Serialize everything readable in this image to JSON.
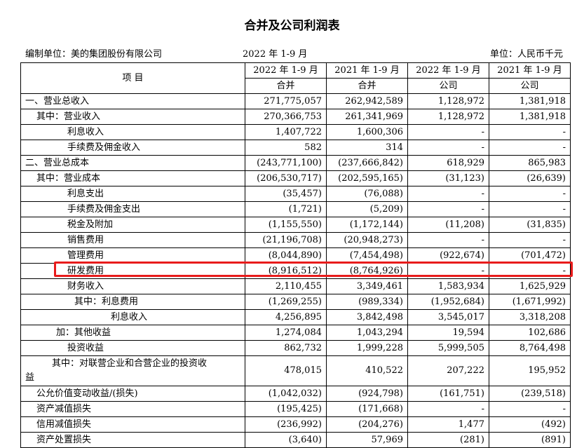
{
  "title": "合并及公司利润表",
  "meta": {
    "company": "编制单位：美的集团股份有限公司",
    "period": "2022 年 1-9 月",
    "unit": "单位：人民币千元"
  },
  "header": {
    "item": "项  目",
    "periods": [
      "2022 年 1-9 月",
      "2021 年 1-9 月",
      "2022 年 1-9 月",
      "2021 年 1-9 月"
    ],
    "scopes": [
      "合并",
      "合并",
      "公司",
      "公司"
    ]
  },
  "rows": [
    {
      "label": "一、营业总收入",
      "values": [
        "271,775,057",
        "262,942,589",
        "1,128,972",
        "1,381,918"
      ]
    },
    {
      "label": "其中：营业收入",
      "values": [
        "270,366,753",
        "261,341,969",
        "1,128,972",
        "1,381,918"
      ]
    },
    {
      "label": "利息收入",
      "values": [
        "1,407,722",
        "1,600,306",
        "-",
        "-"
      ]
    },
    {
      "label": "手续费及佣金收入",
      "values": [
        "582",
        "314",
        "-",
        "-"
      ]
    },
    {
      "label": "二、营业总成本",
      "values": [
        "(243,771,100)",
        "(237,666,842)",
        "618,929",
        "865,983"
      ]
    },
    {
      "label": "其中：营业成本",
      "values": [
        "(206,530,717)",
        "(202,595,165)",
        "(31,123)",
        "(26,639)"
      ]
    },
    {
      "label": "利息支出",
      "values": [
        "(35,457)",
        "(76,088)",
        "-",
        "-"
      ]
    },
    {
      "label": "手续费及佣金支出",
      "values": [
        "(1,721)",
        "(5,209)",
        "-",
        "-"
      ]
    },
    {
      "label": "税金及附加",
      "values": [
        "(1,155,550)",
        "(1,172,144)",
        "(11,208)",
        "(31,835)"
      ]
    },
    {
      "label": "销售费用",
      "values": [
        "(21,196,708)",
        "(20,948,273)",
        "-",
        "-"
      ]
    },
    {
      "label": "管理费用",
      "values": [
        "(8,044,890)",
        "(7,454,498)",
        "(922,674)",
        "(701,472)"
      ]
    },
    {
      "label": "研发费用",
      "values": [
        "(8,916,512)",
        "(8,764,926)",
        "-",
        "-"
      ]
    },
    {
      "label": "财务收入",
      "values": [
        "2,110,455",
        "3,349,461",
        "1,583,934",
        "1,625,929"
      ]
    },
    {
      "label": "其中：利息费用",
      "values": [
        "(1,269,255)",
        "(989,334)",
        "(1,952,684)",
        "(1,671,992)"
      ]
    },
    {
      "label": "利息收入",
      "values": [
        "4,256,895",
        "3,842,498",
        "3,545,017",
        "3,318,208"
      ]
    },
    {
      "label": "加：其他收益",
      "values": [
        "1,274,084",
        "1,043,294",
        "19,594",
        "102,686"
      ]
    },
    {
      "label": "投资收益",
      "values": [
        "862,732",
        "1,999,228",
        "5,999,505",
        "8,764,498"
      ]
    },
    {
      "label_line1": "其中：对联营企业和合营企业的投资收",
      "label_line2": "益",
      "values": [
        "478,015",
        "410,522",
        "207,222",
        "195,952"
      ]
    },
    {
      "label": "公允价值变动收益/(损失)",
      "values": [
        "(1,042,032)",
        "(924,798)",
        "(161,751)",
        "(239,518)"
      ]
    },
    {
      "label": "资产减值损失",
      "values": [
        "(195,425)",
        "(171,668)",
        "-",
        "-"
      ]
    },
    {
      "label": "信用减值损失",
      "values": [
        "(236,992)",
        "(204,276)",
        "1,477",
        "(492)"
      ]
    },
    {
      "label": "资产处置损失",
      "values": [
        "(3,640)",
        "57,969",
        "(281)",
        "(891)"
      ]
    }
  ],
  "highlight_color": "#e81b1b"
}
